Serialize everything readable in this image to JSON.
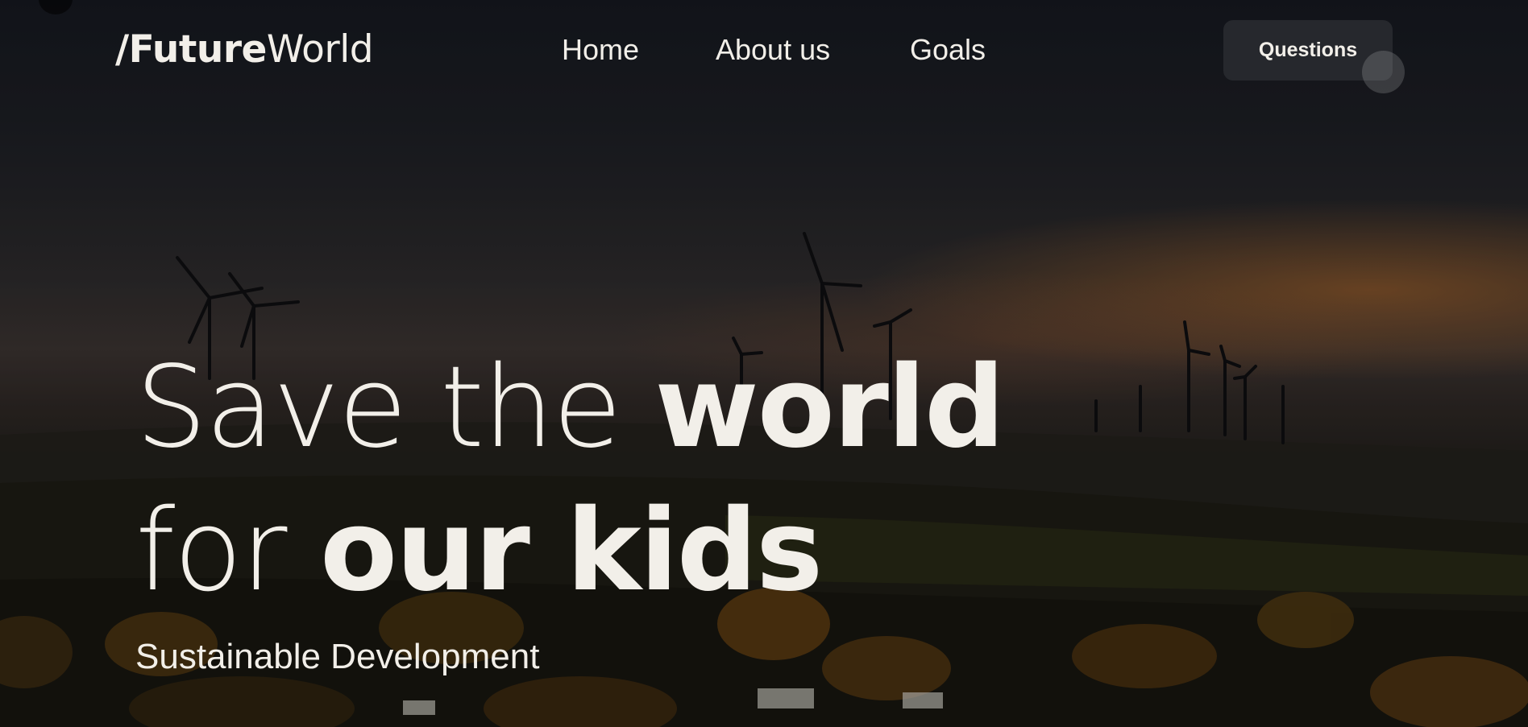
{
  "brand": {
    "slash": "/",
    "bold": "Future",
    "light": "World"
  },
  "nav": {
    "home": "Home",
    "about": "About us",
    "goals": "Goals"
  },
  "header_button": "Questions",
  "hero": {
    "line1_thin": "Save the ",
    "line1_bold": "world",
    "line2_thin": "for ",
    "line2_bold": "our kids",
    "subtitle": "Sustainable Development"
  },
  "colors": {
    "text": "#f2efe9",
    "button_bg": "#26282d",
    "sunset_glow": "#be6e28"
  },
  "background_image": "wind-turbines-at-sunset-over-hills"
}
